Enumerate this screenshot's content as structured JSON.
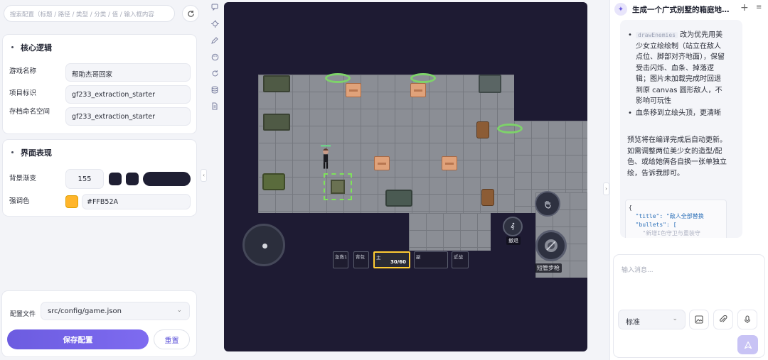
{
  "left": {
    "search_placeholder": "搜索配置（标题 / 路径 / 类型 / 分类 / 值 / 输入框内容",
    "core": {
      "title": "核心逻辑",
      "fields": [
        {
          "label": "游戏名称",
          "value": "帮助杰哥回家"
        },
        {
          "label": "项目标识",
          "value": "gf233_extraction_starter"
        },
        {
          "label": "存档命名空间",
          "value": "gf233_extraction_starter"
        }
      ]
    },
    "ui": {
      "title": "界面表现",
      "bg_label": "背景渐变",
      "bg_value": "155",
      "bg_colors": [
        "#1f1f33",
        "#1f1f33",
        "#1f1f33"
      ],
      "accent_label": "强调色",
      "accent_value": "#FFB52A",
      "accent_color": "#FFB52A"
    },
    "config_file_label": "配置文件",
    "config_file_value": "src/config/game.json",
    "save_label": "保存配置",
    "reset_label": "重置"
  },
  "game": {
    "hotbar": [
      {
        "label": "急救1"
      },
      {
        "label": "背包"
      },
      {
        "label": "主",
        "ammo": "30/60"
      },
      {
        "label": "副"
      },
      {
        "label": "近战"
      }
    ],
    "interact_label": "撤退",
    "fire_label": "短管步枪"
  },
  "chat": {
    "title": "生成一个广式别墅的箱庭地…",
    "code_token": "drawEnemies",
    "msg_bullet1_rest": "改为优先用美少女立绘绘制（站立在敌人点位、脚部对齐地面），保留受击闪烁、血条、掉落逻辑；图片未加载完成时回退到原 canvas 圆形敌人，不影响可玩性",
    "msg_bullet2": "血条移到立绘头顶，更清晰",
    "msg_para": "预览将在编译完成后自动更新。如需调整两位美少女的造型/配色、或给她俩各自换一张单独立绘，告诉我即可。",
    "code_lines": [
      "{",
      "  \"title\": \"敌人全部替换",
      "  \"bullets\": [",
      "    \"新增I色守卫与重装守"
    ],
    "input_placeholder": "输入消息...",
    "mode": "标准"
  }
}
